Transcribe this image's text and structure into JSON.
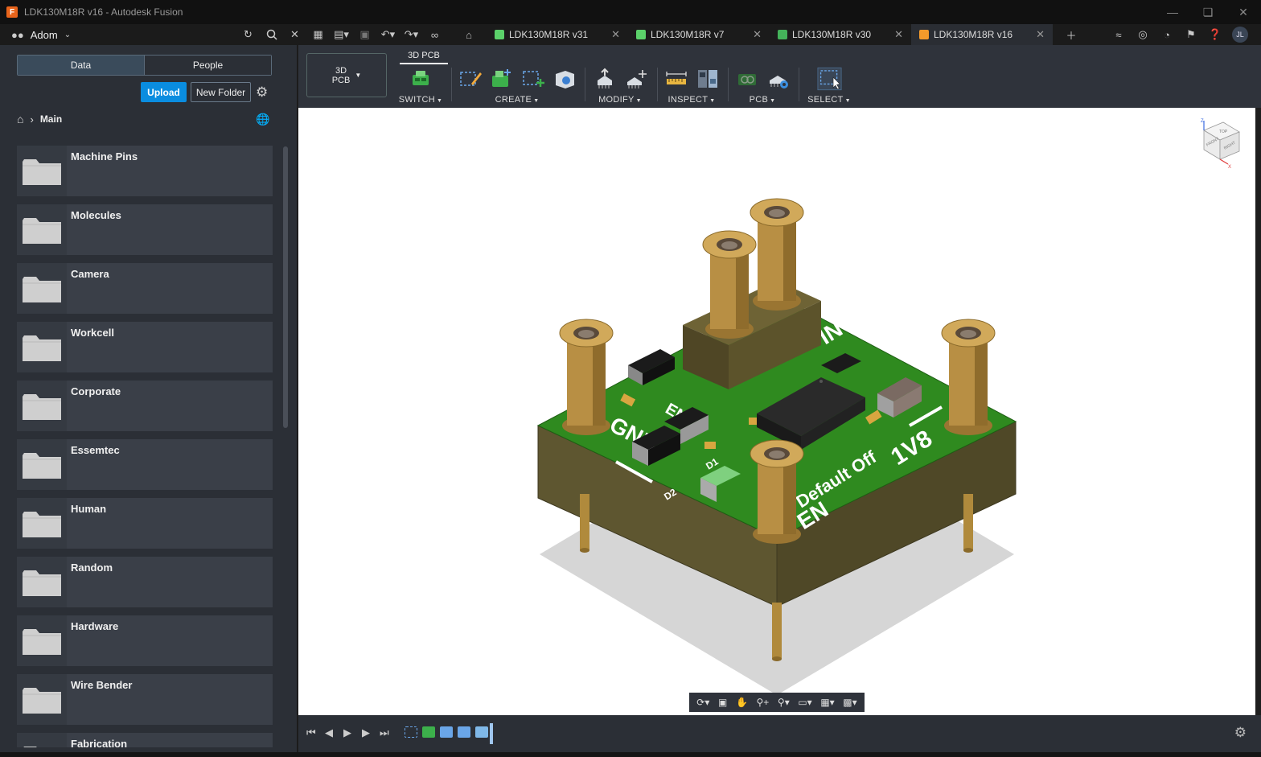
{
  "window": {
    "title": "LDK130M18R v16 - Autodesk Fusion",
    "controls": [
      "minimize",
      "restore",
      "close"
    ]
  },
  "appbar": {
    "team_name": "Adom",
    "icons": [
      "refresh-icon",
      "search-icon",
      "close-icon",
      "grid-icon",
      "file-icon",
      "save-icon",
      "undo-icon",
      "redo-icon",
      "link-icon"
    ],
    "tabs": [
      {
        "label": "LDK130M18R v31",
        "type": "schematic",
        "color": "#5bd16a",
        "active": false
      },
      {
        "label": "LDK130M18R v7",
        "type": "pcb",
        "color": "#5bd16a",
        "active": false
      },
      {
        "label": "LDK130M18R v30",
        "type": "board",
        "color": "#44b35a",
        "active": false
      },
      {
        "label": "LDK130M18R v16",
        "type": "3d",
        "color": "#f39a2b",
        "active": true
      }
    ],
    "user_initials": "JL"
  },
  "data_panel": {
    "segments": [
      "Data",
      "People"
    ],
    "active_segment": "Data",
    "upload_label": "Upload",
    "new_folder_label": "New Folder",
    "breadcrumb": "Main",
    "folders": [
      "Machine Pins",
      "Molecules",
      "Camera",
      "Workcell",
      "Corporate",
      "Essemtec",
      "Human",
      "Random",
      "Hardware",
      "Wire Bender",
      "Fabrication"
    ]
  },
  "toolbar": {
    "workspace_line1": "3D",
    "workspace_line2": "PCB",
    "active_tab": "3D PCB",
    "groups": [
      "SWITCH",
      "CREATE",
      "MODIFY",
      "INSPECT",
      "PCB",
      "SELECT"
    ]
  },
  "viewport": {
    "viewcube_faces": [
      "TOP",
      "FRONT",
      "RIGHT"
    ],
    "viewcube_axes": [
      "Z",
      "X"
    ],
    "silk_labels": [
      "GND",
      "EN",
      "1V8",
      "Default Off",
      "EN",
      "D2",
      "D1",
      "IN"
    ],
    "board_color": "#2f8a1f"
  }
}
